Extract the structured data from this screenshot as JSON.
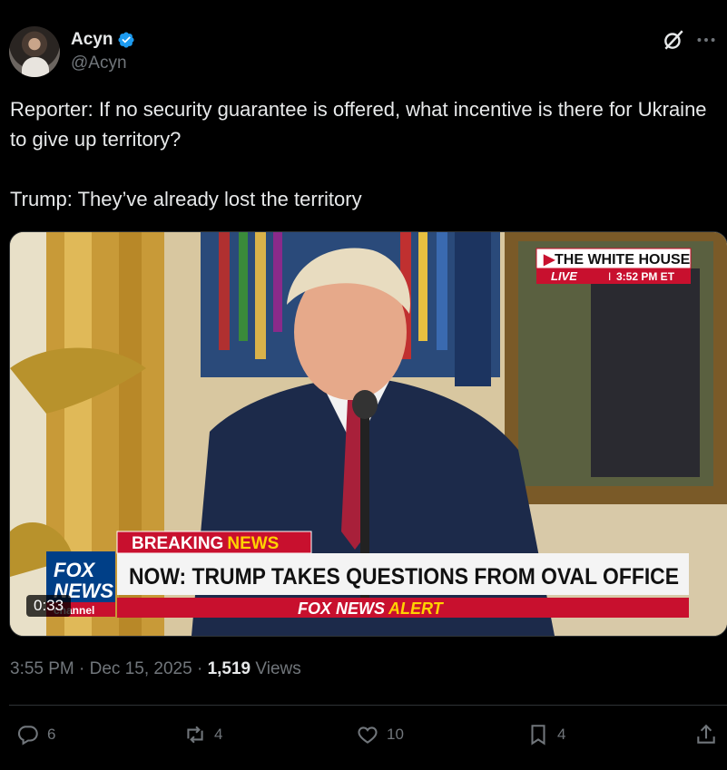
{
  "author": {
    "display_name": "Acyn",
    "handle": "@Acyn",
    "verified": true,
    "verified_color": "#1d9bf0"
  },
  "header_icons": [
    "grok-icon",
    "more-icon"
  ],
  "tweet": {
    "text": "Reporter: If no security guarantee is offered, what incentive is there for Ukraine to give up territory?\n\nTrump: They’ve already lost the territory"
  },
  "video": {
    "duration": "0:33",
    "overlay": {
      "location_banner": "THE WHITE HOUSE",
      "live_label": "LIVE",
      "live_time": "3:52 PM ET",
      "breaking_label_1": "BREAKING",
      "breaking_label_2": "NEWS",
      "headline": "NOW: TRUMP TAKES QUESTIONS FROM OVAL OFFICE",
      "alert_label_1": "FOX NEWS",
      "alert_label_2": "ALERT",
      "channel_logo_1": "FOX",
      "channel_logo_2": "NEWS",
      "channel_logo_3": "channel"
    }
  },
  "meta": {
    "timestamp": "3:55 PM · Dec 15, 2025",
    "separator": " · ",
    "views_count": "1,519",
    "views_label": "Views"
  },
  "actions": {
    "replies": "6",
    "reposts": "4",
    "likes": "10",
    "bookmarks": "4"
  },
  "colors": {
    "background": "#000000",
    "text": "#e7e9ea",
    "muted": "#71767b",
    "divider": "#2f3336",
    "fox_red": "#c8102e",
    "fox_blue": "#003f87"
  }
}
